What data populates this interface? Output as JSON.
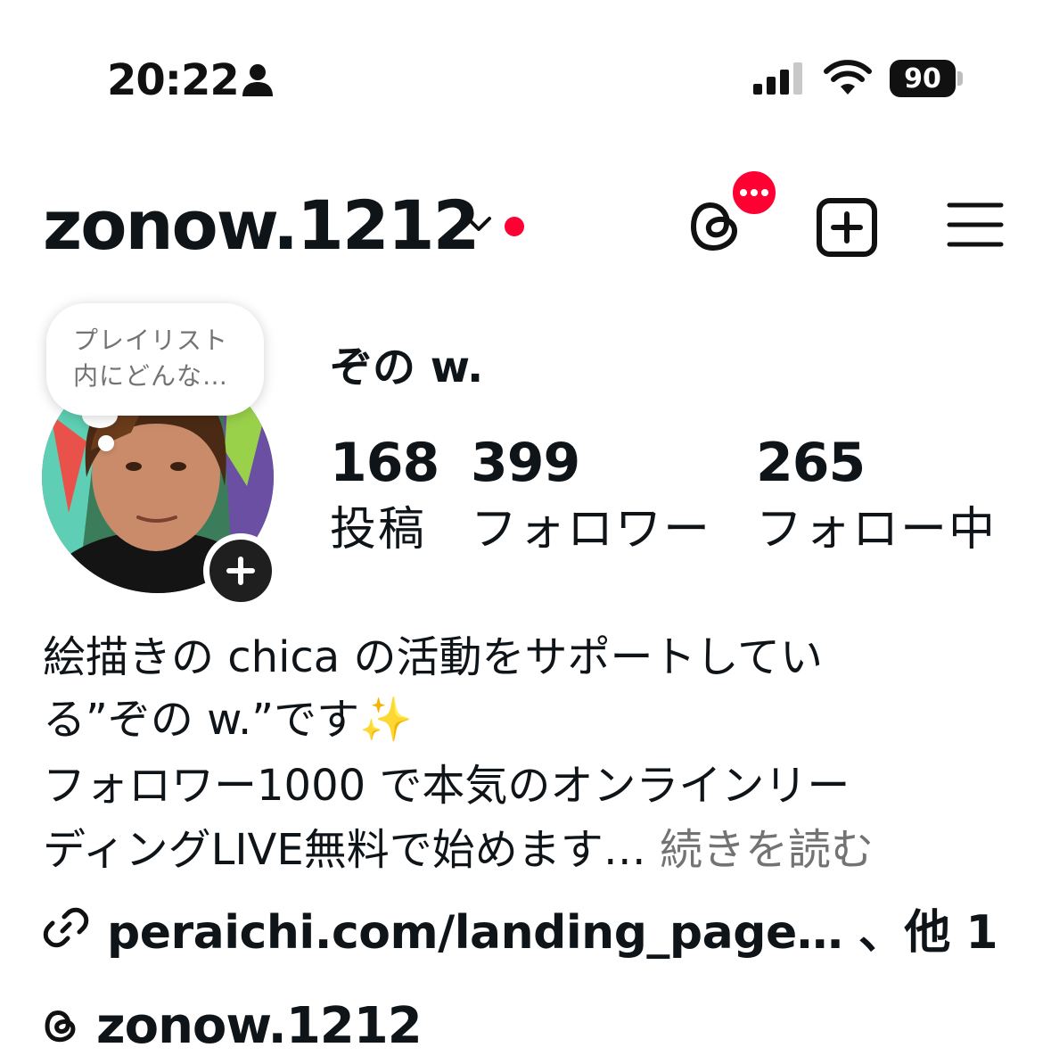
{
  "status_bar": {
    "time": "20:22",
    "battery": "90"
  },
  "header": {
    "username": "zonow.1212",
    "threads_badge": "•••"
  },
  "profile": {
    "note": {
      "line1": "プレイリスト",
      "line2": "内にどんな…"
    },
    "display_name": "ぞの w.",
    "stats": [
      {
        "value": "168",
        "label": "投稿"
      },
      {
        "value": "399",
        "label": "フォロワー"
      },
      {
        "value": "265",
        "label": "フォロー中"
      }
    ]
  },
  "bio": {
    "line1": "絵描きの chica の活動をサポートしてい",
    "line2": "る”ぞの w.”です",
    "sparkle": "✨",
    "line3": "フォロワー1000 で本気のオンラインリー",
    "line4": "ディングLIVE無料で始めます…",
    "more": "続きを読む"
  },
  "links": {
    "text": "peraichi.com/landing_page… 、他 1"
  },
  "threads": {
    "handle": "zonow.1212"
  },
  "icons": {
    "person": "person-icon",
    "signal": "cellular-signal-icon",
    "wifi": "wifi-icon",
    "chevron": "chevron-down-icon",
    "threads": "threads-icon",
    "create": "plus-square-icon",
    "menu": "hamburger-menu-icon",
    "link": "link-icon"
  },
  "colors": {
    "notification_red": "#ff0033",
    "secondary_text": "#737373"
  }
}
